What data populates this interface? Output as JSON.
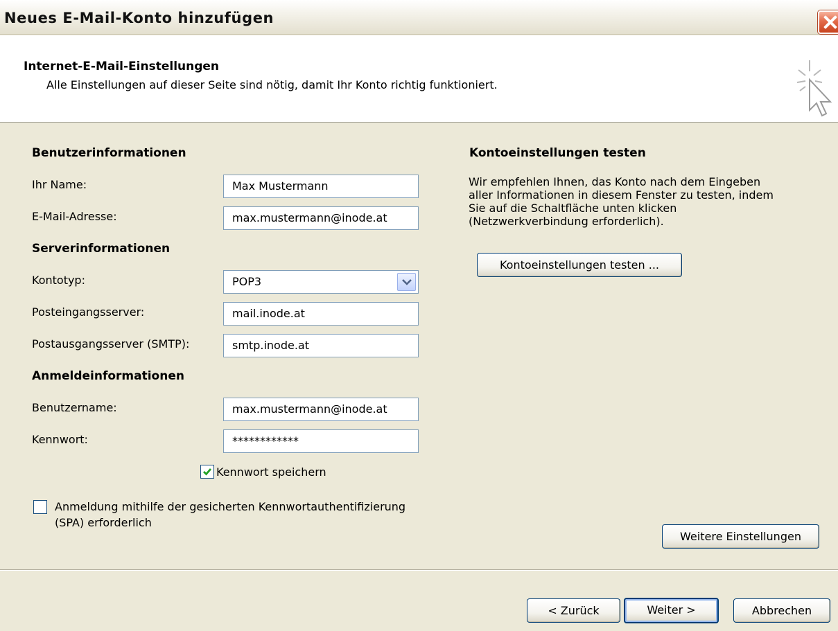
{
  "window": {
    "title": "Neues E-Mail-Konto hinzufügen"
  },
  "header": {
    "title": "Internet-E-Mail-Einstellungen",
    "subtitle": "Alle Einstellungen auf dieser Seite sind nötig, damit Ihr Konto richtig funktioniert."
  },
  "user_info": {
    "heading": "Benutzerinformationen",
    "name_label": "Ihr Name:",
    "name_value": "Max Mustermann",
    "email_label": "E-Mail-Adresse:",
    "email_value": "max.mustermann@inode.at"
  },
  "server_info": {
    "heading": "Serverinformationen",
    "account_type_label": "Kontotyp:",
    "account_type_value": "POP3",
    "incoming_label": "Posteingangsserver:",
    "incoming_value": "mail.inode.at",
    "outgoing_label": "Postausgangsserver (SMTP):",
    "outgoing_value": "smtp.inode.at"
  },
  "login_info": {
    "heading": "Anmeldeinformationen",
    "username_label": "Benutzername:",
    "username_value": "max.mustermann@inode.at",
    "password_label": "Kennwort:",
    "password_value": "************",
    "save_password_label": "Kennwort speichern",
    "save_password_checked": true,
    "spa_label_line1": "Anmeldung mithilfe der gesicherten Kennwortauthentifizierung",
    "spa_label_line2": "(SPA) erforderlich",
    "spa_checked": false
  },
  "test_settings": {
    "heading": "Kontoeinstellungen testen",
    "text_lines": [
      "Wir empfehlen Ihnen, das Konto nach dem Eingeben",
      "aller Informationen in diesem Fenster zu testen, indem",
      "Sie auf die Schaltfläche unten klicken",
      "(Netzwerkverbindung erforderlich)."
    ],
    "test_button": "Kontoeinstellungen testen ..."
  },
  "buttons": {
    "more_settings": "Weitere Einstellungen",
    "back": "< Zurück",
    "next": "Weiter >",
    "cancel": "Abbrechen"
  },
  "colors": {
    "dialog_bg": "#ece9d8",
    "checkmark": "#21a121",
    "close_button": "#e36b4a"
  }
}
